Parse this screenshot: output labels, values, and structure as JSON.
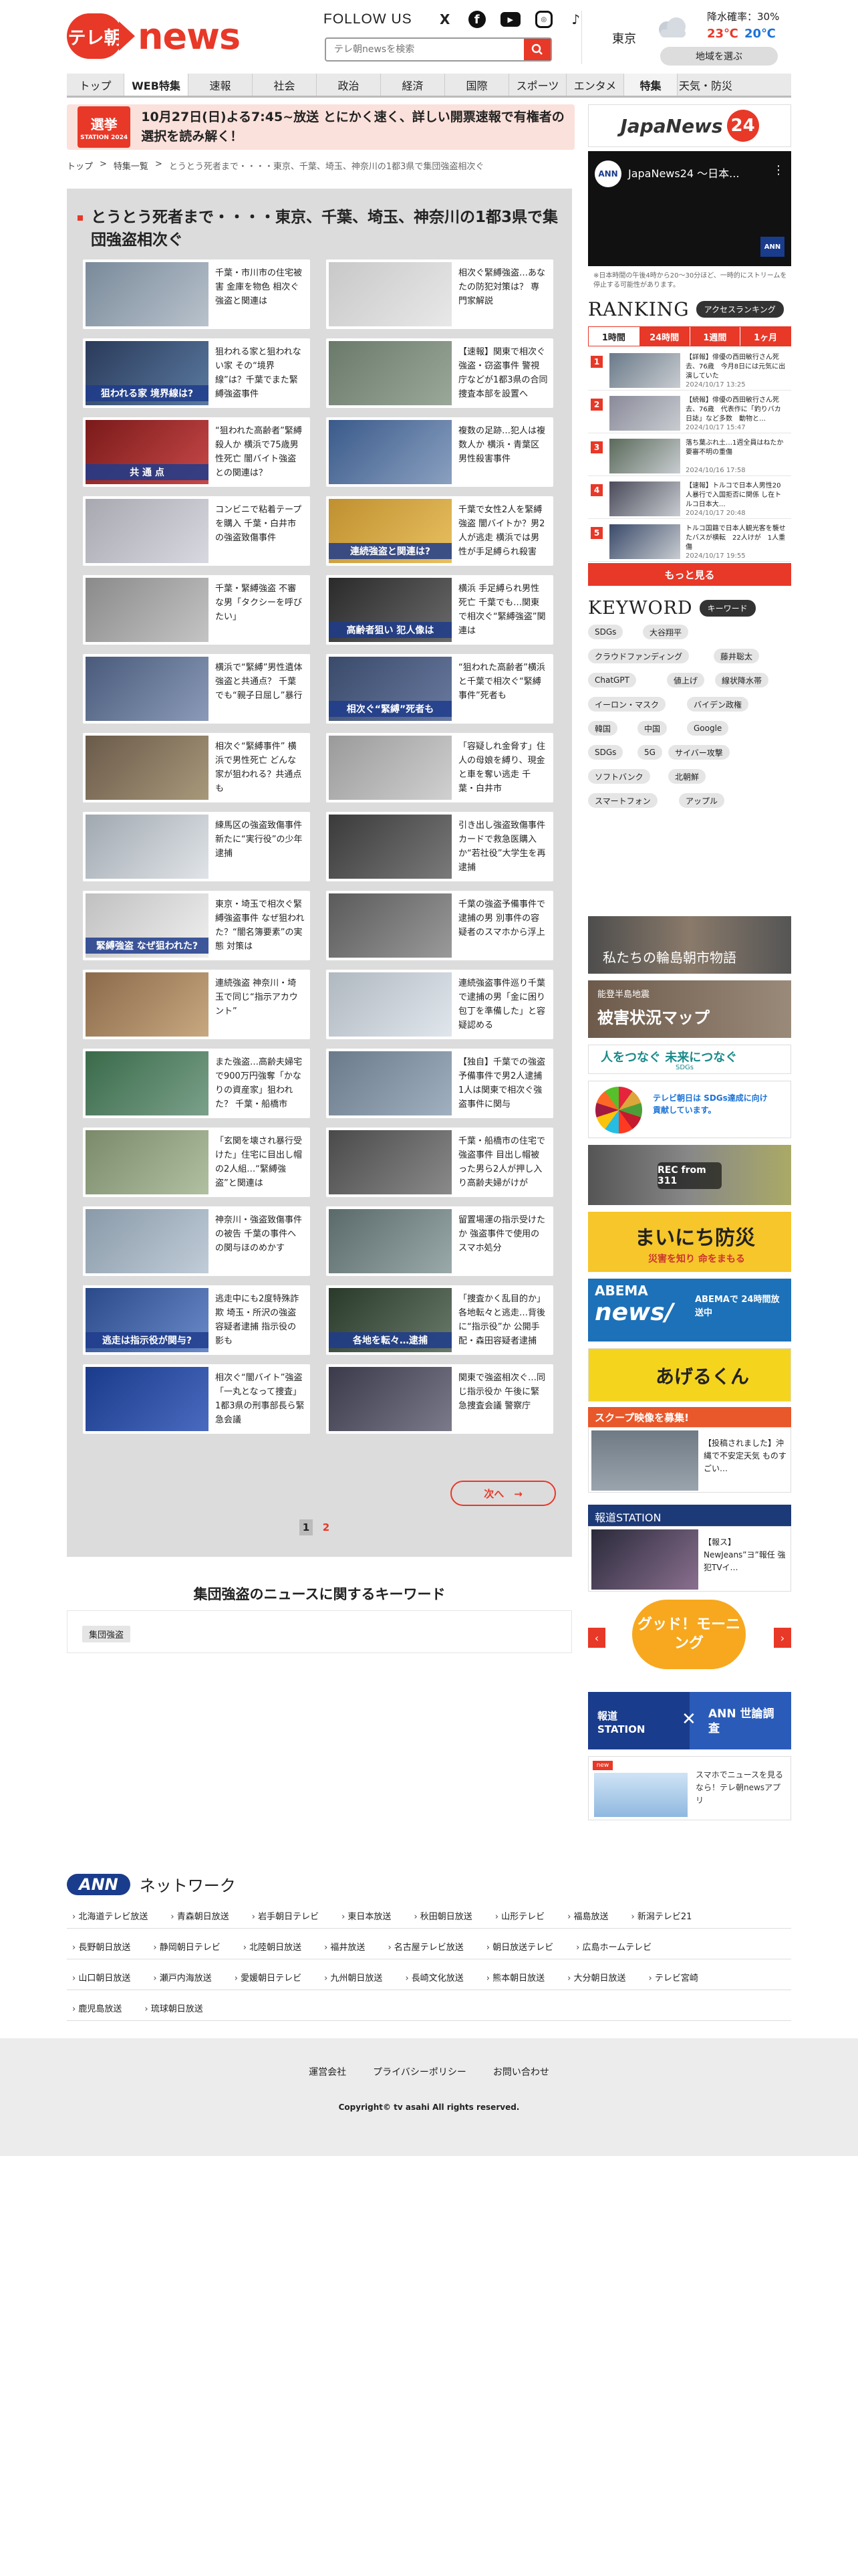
{
  "header": {
    "logo_badge": "テレ朝",
    "logo_text": "news",
    "follow_label": "FOLLOW US",
    "sns": [
      "X",
      "f",
      "▶",
      "◎",
      "♪"
    ],
    "search_placeholder": "テレ朝newsを検索",
    "weather": {
      "city": "東京",
      "rain": "降水確率：30%",
      "high": "23℃",
      "low": "20℃",
      "choose_region": "地域を選ぶ"
    }
  },
  "nav": [
    "トップ",
    "WEB特集",
    "速報",
    "社会",
    "政治",
    "経済",
    "国際",
    "スポーツ",
    "エンタメ",
    "特集",
    "天気・防災"
  ],
  "banner": {
    "logo_line1": "選挙",
    "logo_line2": "STATION 2024",
    "text": "10月27日(日)よる7:45~放送 とにかく速く、詳しい開票速報で有権者の選択を読み解く！"
  },
  "breadcrumb": [
    "トップ",
    ">",
    "特集一覧",
    ">",
    "とうとう死者まで・・・・東京、千葉、埼玉、神奈川の1都3県で集団強盗相次ぐ"
  ],
  "feature": {
    "title": "とうとう死者まで・・・・東京、千葉、埼玉、神奈川の1都3県で集団強盗相次ぐ",
    "articles": [
      {
        "text": "千葉・市川市の住宅被害 金庫を物色 相次ぐ強盗と関連は",
        "cap": ""
      },
      {
        "text": "相次ぐ緊縛強盗…あなたの防犯対策は？ 専門家解説",
        "cap": ""
      },
      {
        "text": "狙われる家と狙われない家 その“境界線”は？千葉でまた緊縛強盗事件",
        "cap": "狙われる家 境界線は?"
      },
      {
        "text": "【速報】関東で相次ぐ強盗・窃盗事件 警視庁などが1都3県の合同捜査本部を設置へ",
        "cap": ""
      },
      {
        "text": "“狙われた高齢者”緊縛殺人か 横浜で75歳男性死亡 闇バイト強盗との関連は？",
        "cap": "共 通 点"
      },
      {
        "text": "複数の足跡…犯人は複数人か 横浜・青葉区 男性殺害事件",
        "cap": ""
      },
      {
        "text": "コンビニで粘着テープを購入 千葉・白井市の強盗致傷事件",
        "cap": ""
      },
      {
        "text": "千葉で女性2人を緊縛強盗 闇バイトか？男2人が逃走 横浜では男性が手足縛られ殺害",
        "cap": "連続強盗と関連は?"
      },
      {
        "text": "千葉・緊縛強盗 不審な男「タクシーを呼びたい」",
        "cap": ""
      },
      {
        "text": "横浜 手足縛られ男性死亡 千葉でも…関東で相次ぐ“緊縛強盗”関連は",
        "cap": "高齢者狙い 犯人像は"
      },
      {
        "text": "横浜で“緊縛”男性遺体 強盗と共通点？ 千葉でも“親子日屈し”暴行",
        "cap": ""
      },
      {
        "text": "“狙われた高齢者”横浜と千葉で相次ぐ“緊縛事件”死者も",
        "cap": "相次ぐ“緊縛”死者も"
      },
      {
        "text": "相次ぐ“緊縛事件” 横浜で男性死亡 どんな家が狙われる？共通点も",
        "cap": ""
      },
      {
        "text": "「容疑しれ金脅す」住人の母娘を縛り、現金と車を奪い逃走 千葉・白井市",
        "cap": ""
      },
      {
        "text": "練馬区の強盗致傷事件 新たに“実行役”の少年逮捕",
        "cap": ""
      },
      {
        "text": "引き出し強盗致傷事件 カードで救急医購入か“若社役”大学生を再逮捕",
        "cap": ""
      },
      {
        "text": "東京・埼玉で相次ぐ緊縛強盗事件 なぜ狙われた？“闇名簿要素”の実態 対策は",
        "cap": "緊縛強盗 なぜ狙われた?"
      },
      {
        "text": "千葉の強盗予備事件で逮捕の男 別事件の容疑者のスマホから浮上",
        "cap": ""
      },
      {
        "text": "連続強盗 神奈川・埼玉で同じ“指示アカウント”",
        "cap": ""
      },
      {
        "text": "連続強盗事件巡り千葉で逮捕の男「金に困り包丁を準備した」と容疑認める",
        "cap": ""
      },
      {
        "text": "また強盗…高齢夫婦宅で900万円強奪「かなりの資産家」狙われた？ 千葉・船橋市",
        "cap": ""
      },
      {
        "text": "【独自】千葉での強盗予備事件で男2人逮捕 1人は関東で相次ぐ強盗事件に関与",
        "cap": ""
      },
      {
        "text": "「玄関を壊され暴行受けた」住宅に目出し帽の2人組…“緊縛強盗”と関連は",
        "cap": ""
      },
      {
        "text": "千葉・船橋市の住宅で強盗事件 目出し帽被った男ら2人が押し入り高齢夫婦がけが",
        "cap": ""
      },
      {
        "text": "神奈川・強盗致傷事件の被告 千葉の事件への関与ほのめかす",
        "cap": ""
      },
      {
        "text": "留置場運の指示受けたか 強盗事件で使用のスマホ処分",
        "cap": ""
      },
      {
        "text": "逃走中にも2度特殊詐欺 埼玉・所沢の強盗容疑者逮捕 指示役の影も",
        "cap": "逃走は指示役が関与?"
      },
      {
        "text": "「捜査かく乱目的か」各地転々と逃走…背後に“指示役”か 公開手配・森田容疑者逮捕",
        "cap": "各地を転々…逮捕"
      },
      {
        "text": "相次ぐ“闇バイト”強盗「一丸となって捜査」1都3県の刑事部長ら緊急会議",
        "cap": ""
      },
      {
        "text": "関東で強盗相次ぐ…同じ指示役か 午後に緊急捜査会議 警察庁",
        "cap": ""
      }
    ],
    "next_label": "次へ　→",
    "pages": [
      "1",
      "2"
    ]
  },
  "keywords_section": {
    "title": "集団強盗のニュースに関するキーワード",
    "chips": [
      "集団強盗"
    ]
  },
  "sidebar": {
    "jn24_title": "JapaNews",
    "jn24_num": "24",
    "video_title": "JapaNews24 ～日本...",
    "video_channel": "ANN",
    "video_badge": "ANN",
    "note": "※日本時間の午後4時から20～30分ほど、一時的にストリームを停止する可能性があります。",
    "ranking_title": "RANKING",
    "ranking_tag": "アクセスランキング",
    "rank_tabs": [
      "1時間",
      "24時間",
      "1週間",
      "1ヶ月"
    ],
    "rank_items": [
      {
        "num": "1",
        "text": "【詳報】俳優の西田敏行さん死去、76歳　今月8日には元気に出演していた",
        "date": "2024/10/17 13:25"
      },
      {
        "num": "2",
        "text": "【続報】俳優の西田敏行さん死去、76歳　代表作に「釣りバカ日誌」など多数　動物と…",
        "date": "2024/10/17 15:47"
      },
      {
        "num": "3",
        "text": "落ち葉ぶれ土…1週全員はねたか 要審不明の重傷",
        "date": "2024/10/16 17:58"
      },
      {
        "num": "4",
        "text": "【速報】トルコで日本人男性20人暴行で入国拒否に関係 し在トルコ日本大…",
        "date": "2024/10/17 20:48"
      },
      {
        "num": "5",
        "text": "トルコ国籍で日本人観光客を襲せたバスが横転　22人けが　1人重傷",
        "date": "2024/10/17 19:55"
      }
    ],
    "more_label": "もっと見る",
    "keyword_title": "KEYWORD",
    "keyword_tag": "キーワード",
    "keywords": [
      "SDGs",
      "大谷翔平",
      "クラウドファンディング",
      "藤井聡太",
      "ChatGPT",
      "値上げ",
      "線状降水帯",
      "イーロン・マスク",
      "バイデン政権",
      "韓国",
      "中国",
      "Google",
      "SDGs",
      "5G",
      "サイバー攻撃",
      "ソフトバンク",
      "北朝鮮",
      "スマートフォン",
      "アップル"
    ],
    "banners": {
      "wajima": "私たちの輪島朝市物語",
      "noto": "能登半島地震",
      "noto_map": "被害状況マップ",
      "sdgs_line": "人をつなぐ 未来につなぐ",
      "sdgs_sub": "SDGs",
      "sdgs2": "テレビ朝日は SDGs達成に向け 貢献しています。",
      "rec": "REC from 311",
      "bosai": "まいにち防災",
      "bosai_sub": "災害を知り 命をまもる",
      "abema1": "ABEMA",
      "abema2": "news/",
      "abema3": "ABEMAで 24時間放送中",
      "agerukun": "あげるくん",
      "scoop": "スクープ映像を募集!",
      "scoop_caption": "【投稿されました】沖縄で不安定天気 ものすごい…",
      "hodo": "報道STATION",
      "hodo_caption": "【報ス】NewJeans”ヨ”報任 強犯TVイ…",
      "goodmorning": "グッド！モーニング",
      "poll1": "報道 STATION",
      "poll2": "ANN 世論調査",
      "app_text": "スマホでニュースを見るなら！テレ朝newsアプリ",
      "app_new": "new"
    }
  },
  "network": {
    "ann": "ANN",
    "label": "ネットワーク",
    "rows": [
      [
        "北海道テレビ放送",
        "青森朝日放送",
        "岩手朝日テレビ",
        "東日本放送",
        "秋田朝日放送",
        "山形テレビ",
        "福島放送",
        "新潟テレビ21"
      ],
      [
        "長野朝日放送",
        "静岡朝日テレビ",
        "北陸朝日放送",
        "福井放送",
        "名古屋テレビ放送",
        "朝日放送テレビ",
        "広島ホームテレビ"
      ],
      [
        "山口朝日放送",
        "瀬戸内海放送",
        "愛媛朝日テレビ",
        "九州朝日放送",
        "長崎文化放送",
        "熊本朝日放送",
        "大分朝日放送",
        "テレビ宮崎"
      ],
      [
        "鹿児島放送",
        "琉球朝日放送"
      ]
    ]
  },
  "footer": {
    "links": [
      "運営会社",
      "プライバシーポリシー",
      "お問い合わせ"
    ],
    "copyright": "Copyright© tv asahi All rights reserved."
  },
  "colors": {
    "accent": "#e83828",
    "panel": "#dcdcdc",
    "ann": "#1a3c8c"
  }
}
